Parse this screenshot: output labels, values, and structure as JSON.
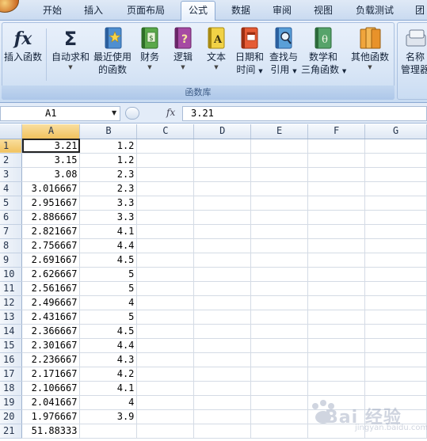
{
  "tabs": [
    {
      "label": "开始",
      "active": false
    },
    {
      "label": "插入",
      "active": false
    },
    {
      "label": "页面布局",
      "active": false
    },
    {
      "label": "公式",
      "active": true
    },
    {
      "label": "数据",
      "active": false
    },
    {
      "label": "审阅",
      "active": false
    },
    {
      "label": "视图",
      "active": false
    },
    {
      "label": "负载测试",
      "active": false
    },
    {
      "label": "团",
      "active": false
    }
  ],
  "ribbon": {
    "group_label": "函数库",
    "buttons": [
      {
        "icon": "fx-icon",
        "line1": "插入函数",
        "line2": "",
        "dropdown": false
      },
      {
        "icon": "sigma-icon",
        "line1": "自动求和",
        "line2": "",
        "dropdown": true
      },
      {
        "icon": "star-book-icon",
        "line1": "最近使用",
        "line2": "的函数",
        "dropdown": true
      },
      {
        "icon": "finance-book-icon",
        "line1": "财务",
        "line2": "",
        "dropdown": true
      },
      {
        "icon": "logic-book-icon",
        "line1": "逻辑",
        "line2": "",
        "dropdown": true
      },
      {
        "icon": "text-book-icon",
        "line1": "文本",
        "line2": "",
        "dropdown": true
      },
      {
        "icon": "calendar-book-icon",
        "line1": "日期和",
        "line2": "时间",
        "dropdown": true
      },
      {
        "icon": "lookup-book-icon",
        "line1": "查找与",
        "line2": "引用",
        "dropdown": true
      },
      {
        "icon": "math-book-icon",
        "line1": "数学和",
        "line2": "三角函数",
        "dropdown": true
      },
      {
        "icon": "more-book-icon",
        "line1": "其他函数",
        "line2": "",
        "dropdown": true
      }
    ],
    "names_button": {
      "line1": "名称",
      "line2": "管理器"
    }
  },
  "formula_bar": {
    "name_box": "A1",
    "fx": "fx",
    "formula": "3.21"
  },
  "grid": {
    "columns": [
      "A",
      "B",
      "C",
      "D",
      "E",
      "F",
      "G"
    ],
    "rows": [
      {
        "n": "1",
        "a": "3.21",
        "b": "1.2"
      },
      {
        "n": "2",
        "a": "3.15",
        "b": "1.2"
      },
      {
        "n": "3",
        "a": "3.08",
        "b": "2.3"
      },
      {
        "n": "4",
        "a": "3.016667",
        "b": "2.3"
      },
      {
        "n": "5",
        "a": "2.951667",
        "b": "3.3"
      },
      {
        "n": "6",
        "a": "2.886667",
        "b": "3.3"
      },
      {
        "n": "7",
        "a": "2.821667",
        "b": "4.1"
      },
      {
        "n": "8",
        "a": "2.756667",
        "b": "4.4"
      },
      {
        "n": "9",
        "a": "2.691667",
        "b": "4.5"
      },
      {
        "n": "10",
        "a": "2.626667",
        "b": "5"
      },
      {
        "n": "11",
        "a": "2.561667",
        "b": "5"
      },
      {
        "n": "12",
        "a": "2.496667",
        "b": "4"
      },
      {
        "n": "13",
        "a": "2.431667",
        "b": "5"
      },
      {
        "n": "14",
        "a": "2.366667",
        "b": "4.5"
      },
      {
        "n": "15",
        "a": "2.301667",
        "b": "4.4"
      },
      {
        "n": "16",
        "a": "2.236667",
        "b": "4.3"
      },
      {
        "n": "17",
        "a": "2.171667",
        "b": "4.2"
      },
      {
        "n": "18",
        "a": "2.106667",
        "b": "4.1"
      },
      {
        "n": "19",
        "a": "2.041667",
        "b": "4"
      },
      {
        "n": "20",
        "a": "1.976667",
        "b": "3.9"
      },
      {
        "n": "21",
        "a": "51.88333",
        "b": ""
      }
    ]
  },
  "watermark": {
    "text": "Bai 经验",
    "sub": "jingyan.baidu.com"
  }
}
